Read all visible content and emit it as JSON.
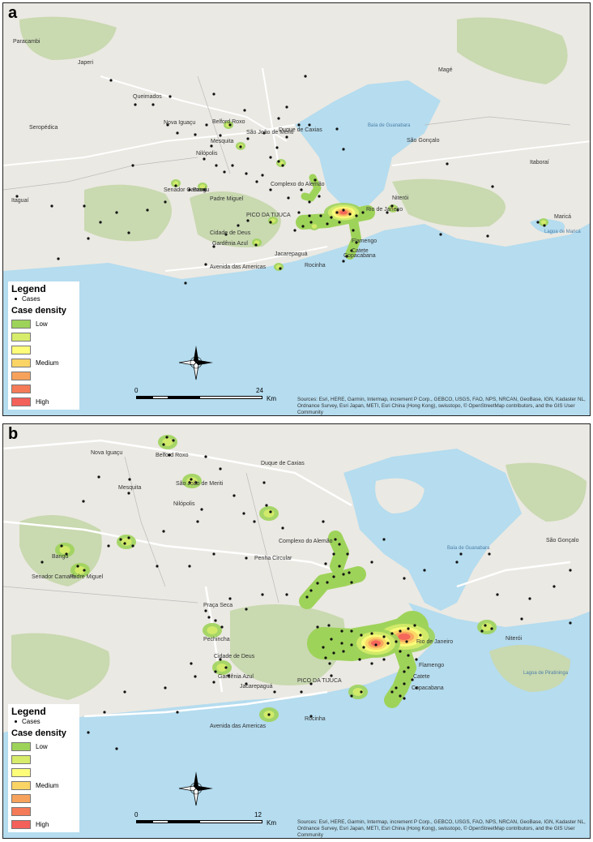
{
  "panels": [
    {
      "label": "a",
      "places": [
        {
          "name": "Paracambi"
        },
        {
          "name": "Japeri"
        },
        {
          "name": "Queimados"
        },
        {
          "name": "Seropédica"
        },
        {
          "name": "Nova Iguaçu"
        },
        {
          "name": "Belford Roxo"
        },
        {
          "name": "Mesquita"
        },
        {
          "name": "Nilópolis"
        },
        {
          "name": "São João de Meriti"
        },
        {
          "name": "Duque de Caxias"
        },
        {
          "name": "Magé"
        },
        {
          "name": "Itaguaí"
        },
        {
          "name": "Senador Camará"
        },
        {
          "name": "Bangu"
        },
        {
          "name": "Padre Miguel"
        },
        {
          "name": "Complexo do Alemão"
        },
        {
          "name": "Cidade de Deus"
        },
        {
          "name": "Gardênia Azul"
        },
        {
          "name": "Rio de Janeiro"
        },
        {
          "name": "Flamengo"
        },
        {
          "name": "Catete"
        },
        {
          "name": "Copacabana"
        },
        {
          "name": "Rocinha"
        },
        {
          "name": "Jacarepaguá"
        },
        {
          "name": "Niterói"
        },
        {
          "name": "São Gonçalo"
        },
        {
          "name": "Itaboraí"
        },
        {
          "name": "Maricá"
        },
        {
          "name": "PICO DA TIJUCA"
        },
        {
          "name": "Avenida das Americas"
        }
      ],
      "water": [
        {
          "name": "Baía de Guanabara"
        },
        {
          "name": "Lagoa de Maricá"
        }
      ],
      "legend": {
        "title": "Legend",
        "cases_label": "Cases",
        "density_title": "Case density",
        "rows": [
          {
            "label": "Low",
            "color": "#9ed35a"
          },
          {
            "label": "",
            "color": "#d6ec6a"
          },
          {
            "label": "",
            "color": "#fdfd7a"
          },
          {
            "label": "Medium",
            "color": "#fbd466"
          },
          {
            "label": "",
            "color": "#f7a25c"
          },
          {
            "label": "",
            "color": "#f47a58"
          },
          {
            "label": "High",
            "color": "#f4605a"
          }
        ]
      },
      "scale": {
        "zero": "0",
        "max": "24",
        "unit": "Km"
      },
      "sources": "Sources: Esri, HERE, Garmin, Intermap, increment P Corp., GEBCO, USGS, FAO, NPS, NRCAN, GeoBase, IGN, Kadaster NL, Ordnance Survey, Esri Japan, METI, Esri China (Hong Kong), swisstopo, © OpenStreetMap contributors, and the GIS User Community"
    },
    {
      "label": "b",
      "places": [
        {
          "name": "Belford Roxo"
        },
        {
          "name": "Nova Iguaçu"
        },
        {
          "name": "Mesquita"
        },
        {
          "name": "Nilópolis"
        },
        {
          "name": "São João de Meriti"
        },
        {
          "name": "Duque de Caxias"
        },
        {
          "name": "Bangu"
        },
        {
          "name": "Senador Camará"
        },
        {
          "name": "Padre Miguel"
        },
        {
          "name": "Penha Circular"
        },
        {
          "name": "Complexo do Alemão"
        },
        {
          "name": "Praça Seca"
        },
        {
          "name": "Pechincha"
        },
        {
          "name": "Cidade de Deus"
        },
        {
          "name": "Gardênia Azul"
        },
        {
          "name": "Jacarepaguá"
        },
        {
          "name": "Rio de Janeiro"
        },
        {
          "name": "Flamengo"
        },
        {
          "name": "Catete"
        },
        {
          "name": "Copacabana"
        },
        {
          "name": "Rocinha"
        },
        {
          "name": "Niterói"
        },
        {
          "name": "São Gonçalo"
        },
        {
          "name": "PICO DA TIJUCA"
        },
        {
          "name": "Avenida das Americas"
        }
      ],
      "water": [
        {
          "name": "Baía de Guanabara"
        },
        {
          "name": "Lagoa de Piratininga"
        }
      ],
      "legend": {
        "title": "Legend",
        "cases_label": "Cases",
        "density_title": "Case density",
        "rows": [
          {
            "label": "Low",
            "color": "#9ed35a"
          },
          {
            "label": "",
            "color": "#d6ec6a"
          },
          {
            "label": "",
            "color": "#fdfd7a"
          },
          {
            "label": "Medium",
            "color": "#fbd466"
          },
          {
            "label": "",
            "color": "#f7a25c"
          },
          {
            "label": "",
            "color": "#f47a58"
          },
          {
            "label": "High",
            "color": "#f4605a"
          }
        ]
      },
      "scale": {
        "zero": "0",
        "max": "12",
        "unit": "Km"
      },
      "sources": "Sources: Esri, HERE, Garmin, Intermap, increment P Corp., GEBCO, USGS, FAO, NPS, NRCAN, GeoBase, IGN, Kadaster NL, Ordnance Survey, Esri Japan, METI, Esri China (Hong Kong), swisstopo, © OpenStreetMap contributors, and the GIS User Community"
    }
  ],
  "colors": {
    "sea": "#b5dcef",
    "land": "#ebe9e3",
    "forest": "#c9d9b0",
    "road": "#ffffff",
    "density_high": "#f4605a",
    "density_low": "#9ed35a"
  }
}
